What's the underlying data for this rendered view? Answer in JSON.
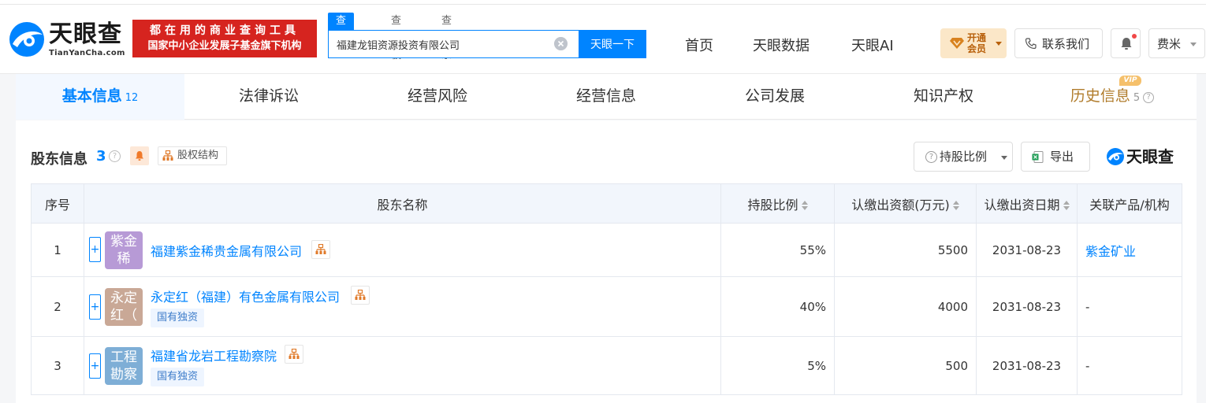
{
  "header": {
    "logo_text": "天眼查",
    "logo_sub": "TianYanCha.com",
    "slogan_line1": "都在用的商业查询工具",
    "slogan_line2": "国家中小企业发展子基金旗下机构",
    "search_tabs": [
      "查公司",
      "查老板",
      "查关系"
    ],
    "search_value": "福建龙钼资源投资有限公司",
    "search_button": "天眼一下",
    "nav": [
      "首页",
      "天眼数据",
      "天眼AI"
    ],
    "vip_label_1": "开通",
    "vip_label_2": "会员",
    "contact_label": "联系我们",
    "user_name": "费米"
  },
  "tabs": [
    {
      "label": "基本信息",
      "count": "12"
    },
    {
      "label": "法律诉讼",
      "count": ""
    },
    {
      "label": "经营风险",
      "count": ""
    },
    {
      "label": "经营信息",
      "count": ""
    },
    {
      "label": "公司发展",
      "count": ""
    },
    {
      "label": "知识产权",
      "count": ""
    },
    {
      "label": "历史信息",
      "count": "5"
    }
  ],
  "vip_badge": "VIP",
  "section": {
    "title": "股东信息",
    "count": "3",
    "struct_label": "股权结构",
    "ratio_label": "持股比例",
    "export_label": "导出",
    "brand": "天眼查"
  },
  "table": {
    "headers": {
      "idx": "序号",
      "name": "股东名称",
      "ratio": "持股比例",
      "capital": "认缴出资额(万元)",
      "date": "认缴出资日期",
      "product": "关联产品/机构"
    },
    "rows": [
      {
        "idx": "1",
        "avatar": "紫金稀",
        "avatar_color": "#b79ad6",
        "name": "福建紫金稀贵金属有限公司",
        "tag": "",
        "ratio": "55%",
        "capital": "5500",
        "date": "2031-08-23",
        "product": "紫金矿业"
      },
      {
        "idx": "2",
        "avatar": "永定红（",
        "avatar_color": "#c9a896",
        "name": "永定红（福建）有色金属有限公司",
        "tag": "国有独资",
        "ratio": "40%",
        "capital": "4000",
        "date": "2031-08-23",
        "product": "-"
      },
      {
        "idx": "3",
        "avatar": "工程勘察",
        "avatar_color": "#7eaed6",
        "name": "福建省龙岩工程勘察院",
        "tag": "国有独资",
        "ratio": "5%",
        "capital": "500",
        "date": "2031-08-23",
        "product": "-"
      }
    ]
  }
}
